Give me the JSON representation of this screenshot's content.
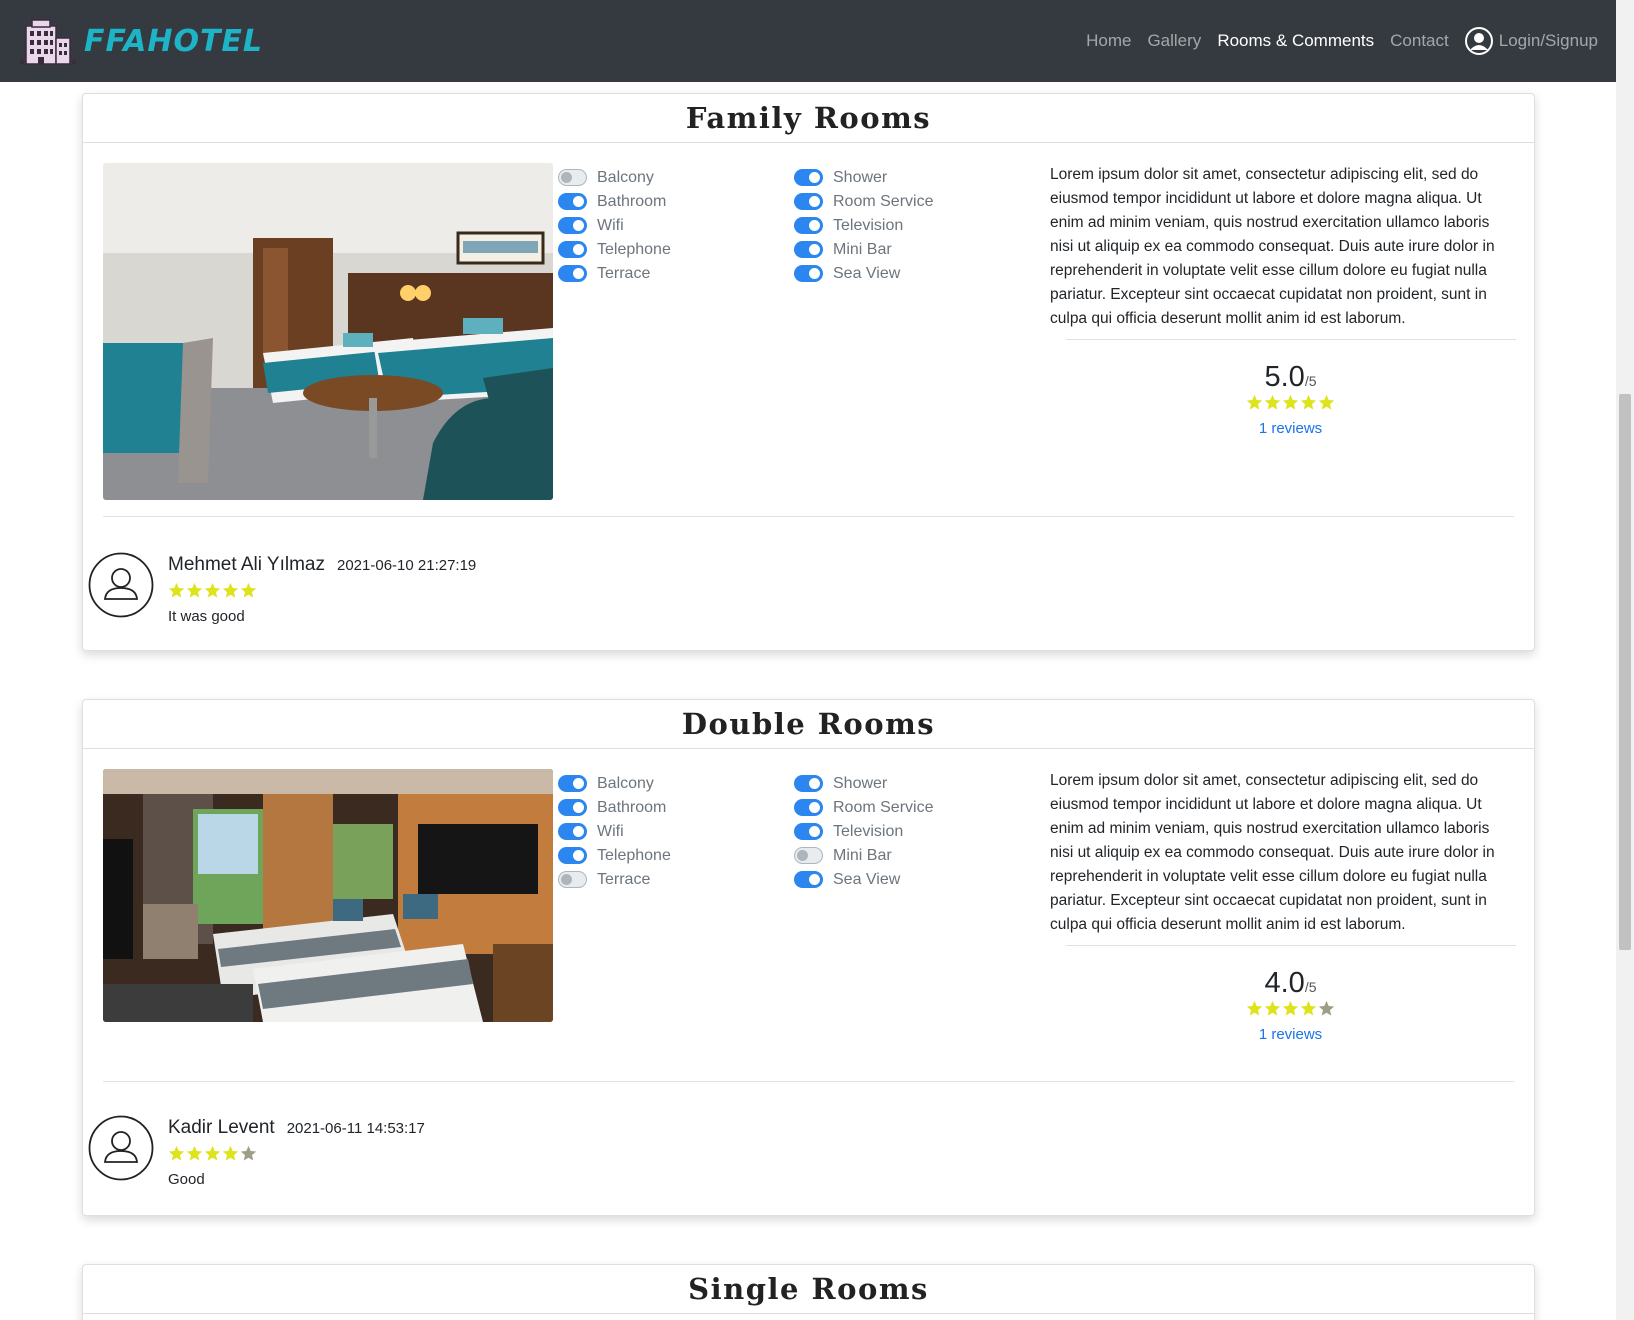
{
  "brand": {
    "name": "FFAHOTEL"
  },
  "nav": {
    "items": [
      {
        "label": "Home",
        "active": false
      },
      {
        "label": "Gallery",
        "active": false
      },
      {
        "label": "Rooms & Comments",
        "active": true
      },
      {
        "label": "Contact",
        "active": false
      }
    ],
    "login_label": "Login/Signup"
  },
  "rooms": [
    {
      "title": "Family Rooms",
      "features_left": [
        {
          "label": "Balcony",
          "enabled": false
        },
        {
          "label": "Bathroom",
          "enabled": true
        },
        {
          "label": "Wifi",
          "enabled": true
        },
        {
          "label": "Telephone",
          "enabled": true
        },
        {
          "label": "Terrace",
          "enabled": true
        }
      ],
      "features_right": [
        {
          "label": "Shower",
          "enabled": true
        },
        {
          "label": "Room Service",
          "enabled": true
        },
        {
          "label": "Television",
          "enabled": true
        },
        {
          "label": "Mini Bar",
          "enabled": true
        },
        {
          "label": "Sea View",
          "enabled": true
        }
      ],
      "description": "Lorem ipsum dolor sit amet, consectetur adipiscing elit, sed do eiusmod tempor incididunt ut labore et dolore magna aliqua. Ut enim ad minim veniam, quis nostrud exercitation ullamco laboris nisi ut aliquip ex ea commodo consequat. Duis aute irure dolor in reprehenderit in voluptate velit esse cillum dolore eu fugiat nulla pariatur. Excepteur sint occaecat cupidatat non proident, sunt in culpa qui officia deserunt mollit anim id est laborum.",
      "score": "5.0",
      "score_max": "/5",
      "stars": 5,
      "reviews_label": "1 reviews",
      "comment": {
        "name": "Mehmet Ali Yılmaz",
        "date": "2021-06-10 21:27:19",
        "stars": 5,
        "text": "It was good"
      }
    },
    {
      "title": "Double Rooms",
      "features_left": [
        {
          "label": "Balcony",
          "enabled": true
        },
        {
          "label": "Bathroom",
          "enabled": true
        },
        {
          "label": "Wifi",
          "enabled": true
        },
        {
          "label": "Telephone",
          "enabled": true
        },
        {
          "label": "Terrace",
          "enabled": false
        }
      ],
      "features_right": [
        {
          "label": "Shower",
          "enabled": true
        },
        {
          "label": "Room Service",
          "enabled": true
        },
        {
          "label": "Television",
          "enabled": true
        },
        {
          "label": "Mini Bar",
          "enabled": false
        },
        {
          "label": "Sea View",
          "enabled": true
        }
      ],
      "description": "Lorem ipsum dolor sit amet, consectetur adipiscing elit, sed do eiusmod tempor incididunt ut labore et dolore magna aliqua. Ut enim ad minim veniam, quis nostrud exercitation ullamco laboris nisi ut aliquip ex ea commodo consequat. Duis aute irure dolor in reprehenderit in voluptate velit esse cillum dolore eu fugiat nulla pariatur. Excepteur sint occaecat cupidatat non proident, sunt in culpa qui officia deserunt mollit anim id est laborum.",
      "score": "4.0",
      "score_max": "/5",
      "stars": 4,
      "reviews_label": "1 reviews",
      "comment": {
        "name": "Kadir Levent",
        "date": "2021-06-11 14:53:17",
        "stars": 4,
        "text": "Good"
      }
    },
    {
      "title": "Single Rooms"
    }
  ],
  "colors": {
    "navbar": "#343a40",
    "brand": "#1eb4c8",
    "switch_on": "#2b86f0",
    "star_on": "#dde31c",
    "star_off": "#9e9e86",
    "link": "#1a73e8"
  }
}
